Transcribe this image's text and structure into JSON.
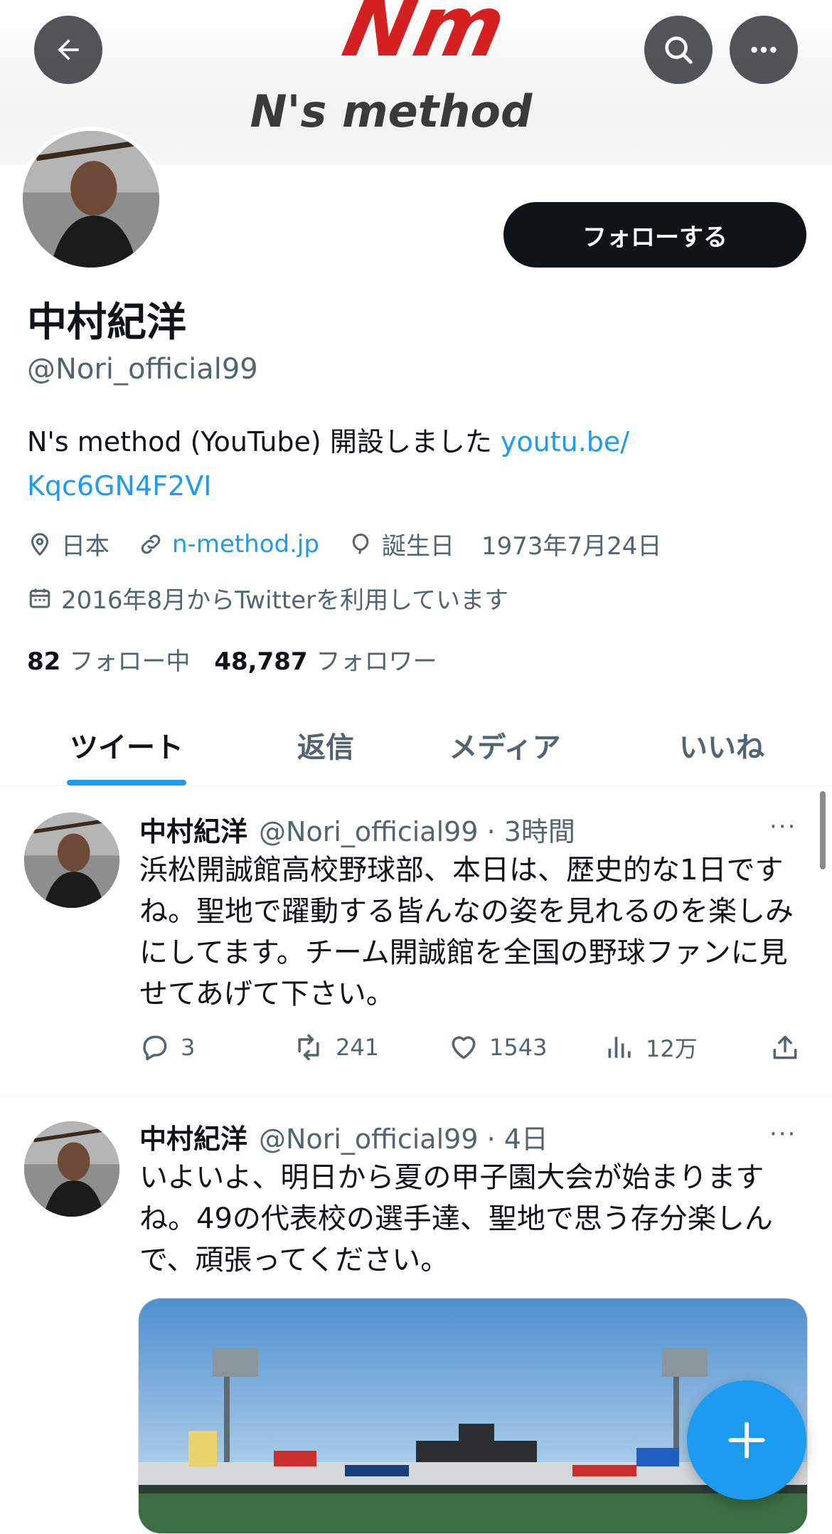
{
  "banner": {
    "logo_main": "Nm",
    "logo_sub": "N's method",
    "back_icon": "arrow-left-icon",
    "search_icon": "search-icon",
    "more_icon": "more-horizontal-icon"
  },
  "profile": {
    "name": "中村紀洋",
    "handle": "@Nori_official99",
    "follow_label": "フォローする",
    "bio_text": "N's method (YouTube) 開設しました ",
    "bio_link_1": "youtu.be/",
    "bio_link_2": "Kqc6GN4F2VI",
    "location": "日本",
    "website": "n-method.jp",
    "birthday_label": "誕生日",
    "birthday": "1973年7月24日",
    "joined": "2016年8月からTwitterを利用しています",
    "following_count": "82",
    "following_label": "フォロー中",
    "followers_count": "48,787",
    "followers_label": "フォロワー"
  },
  "tabs": [
    {
      "label": "ツイート",
      "active": true
    },
    {
      "label": "返信",
      "active": false
    },
    {
      "label": "メディア",
      "active": false
    },
    {
      "label": "いいね",
      "active": false
    }
  ],
  "tweets": [
    {
      "name": "中村紀洋",
      "handle_time": "@Nori_official99 · 3時間",
      "more": "···",
      "text": "浜松開誠館高校野球部、本日は、歴史的な1日ですね。聖地で躍動する皆んなの姿を見れるのを楽しみにしてます。チーム開誠館を全国の野球ファンに見せてあげて下さい。",
      "replies": "3",
      "retweets": "241",
      "likes": "1543",
      "views": "12万"
    },
    {
      "name": "中村紀洋",
      "handle_time": "@Nori_official99 · 4日",
      "more": "···",
      "text": "いよいよ、明日から夏の甲子園大会が始まりますね。49の代表校の選手達、聖地で思う存分楽しんで、頑張ってください。"
    }
  ],
  "fab": {
    "label": "+",
    "icon": "compose-plus-icon"
  },
  "colors": {
    "accent": "#1d9bf0",
    "text": "#0f1419",
    "muted": "#536471",
    "logo_red": "#d42020"
  }
}
